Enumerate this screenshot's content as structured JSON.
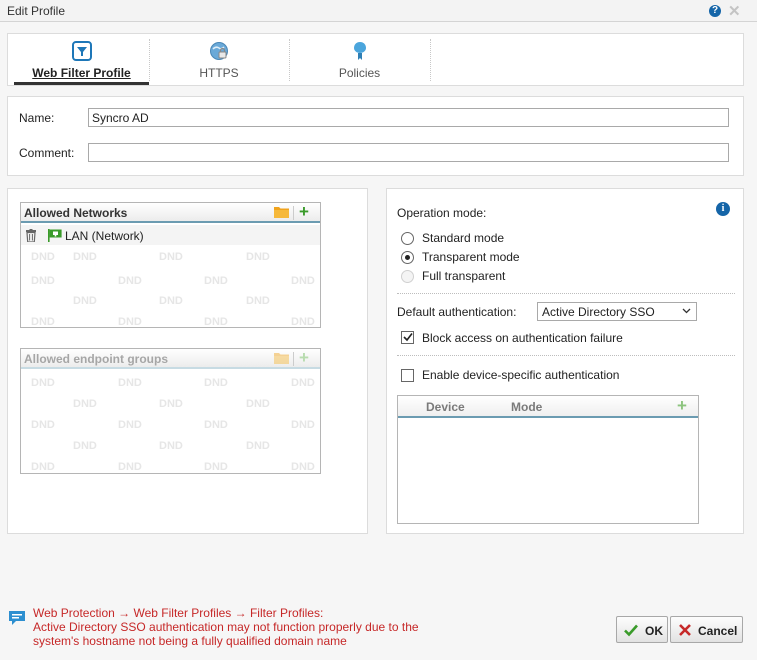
{
  "window": {
    "title": "Edit Profile",
    "help_glyph": "?",
    "close_glyph": "✕"
  },
  "tabs": [
    {
      "label": "Web Filter Profile",
      "icon": "filter-icon",
      "active": true
    },
    {
      "label": "HTTPS",
      "icon": "globe-lock-icon",
      "active": false
    },
    {
      "label": "Policies",
      "icon": "badge-icon",
      "active": false
    }
  ],
  "form": {
    "name_label": "Name:",
    "name_value": "Syncro AD",
    "comment_label": "Comment:",
    "comment_value": ""
  },
  "allowed_networks": {
    "title": "Allowed Networks",
    "items": [
      {
        "label": "LAN (Network)",
        "icon": "network-flag-icon"
      }
    ],
    "watermark": "DND"
  },
  "allowed_endpoint_groups": {
    "title": "Allowed endpoint groups",
    "watermark": "DND"
  },
  "operation": {
    "label": "Operation mode:",
    "options": [
      {
        "label": "Standard mode",
        "checked": false,
        "disabled": false
      },
      {
        "label": "Transparent mode",
        "checked": true,
        "disabled": false
      },
      {
        "label": "Full transparent",
        "checked": false,
        "disabled": true
      }
    ]
  },
  "auth": {
    "label": "Default authentication:",
    "selected": "Active Directory SSO",
    "block_label": "Block access on authentication failure",
    "block_checked": true,
    "device_label": "Enable device-specific authentication",
    "device_checked": false
  },
  "device_table": {
    "columns": [
      "Device",
      "Mode"
    ],
    "rows": []
  },
  "footer": {
    "path": "Web Protection → Web Filter Profiles → Filter Profiles:",
    "line1": "Active Directory SSO authentication may not function properly due to the",
    "line2": "system's hostname not being a fully qualified domain name"
  },
  "buttons": {
    "ok": "OK",
    "cancel": "Cancel"
  },
  "colors": {
    "accent": "#1565a8",
    "warning": "#c62828",
    "ok_green": "#3a9b2a",
    "cancel_red": "#c62828"
  }
}
